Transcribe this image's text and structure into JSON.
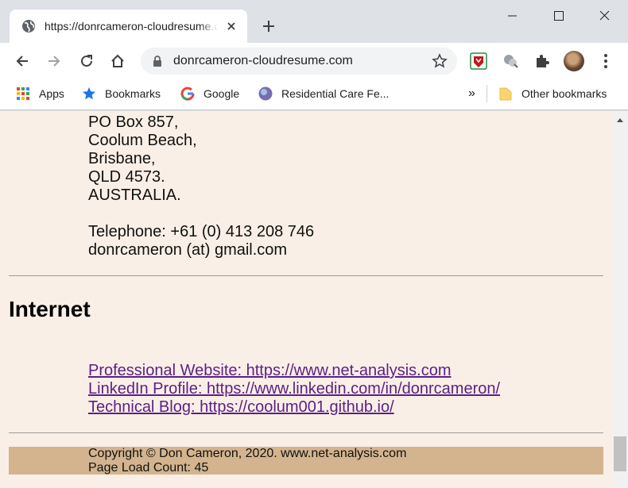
{
  "tab": {
    "title": "https://donrcameron-cloudresume.com"
  },
  "toolbar": {
    "url": "donrcameron-cloudresume.com"
  },
  "bookmarks": {
    "apps": "Apps",
    "bookmarks": "Bookmarks",
    "google": "Google",
    "residential": "Residential Care Fe...",
    "overflow": "»",
    "other": "Other bookmarks"
  },
  "page": {
    "address": [
      "PO Box 857,",
      "Coolum Beach,",
      "Brisbane,",
      "QLD 4573.",
      "AUSTRALIA."
    ],
    "telephone": "Telephone: +61 (0) 413 208 746",
    "email": "donrcameron (at) gmail.com",
    "internet_heading": "Internet",
    "links": [
      "Professional Website: https://www.net-analysis.com",
      "LinkedIn Profile: https://www.linkedin.com/in/donrcameron/",
      "Technical Blog: https://coolum001.github.io/"
    ],
    "footer": {
      "copyright": "Copyright © Don Cameron, 2020. www.net-analysis.com",
      "load_count": "Page Load Count: 45"
    }
  },
  "colors": {
    "page_background": "#faefe6",
    "footer_background": "#d3b48f",
    "link": "#5b1f86"
  }
}
